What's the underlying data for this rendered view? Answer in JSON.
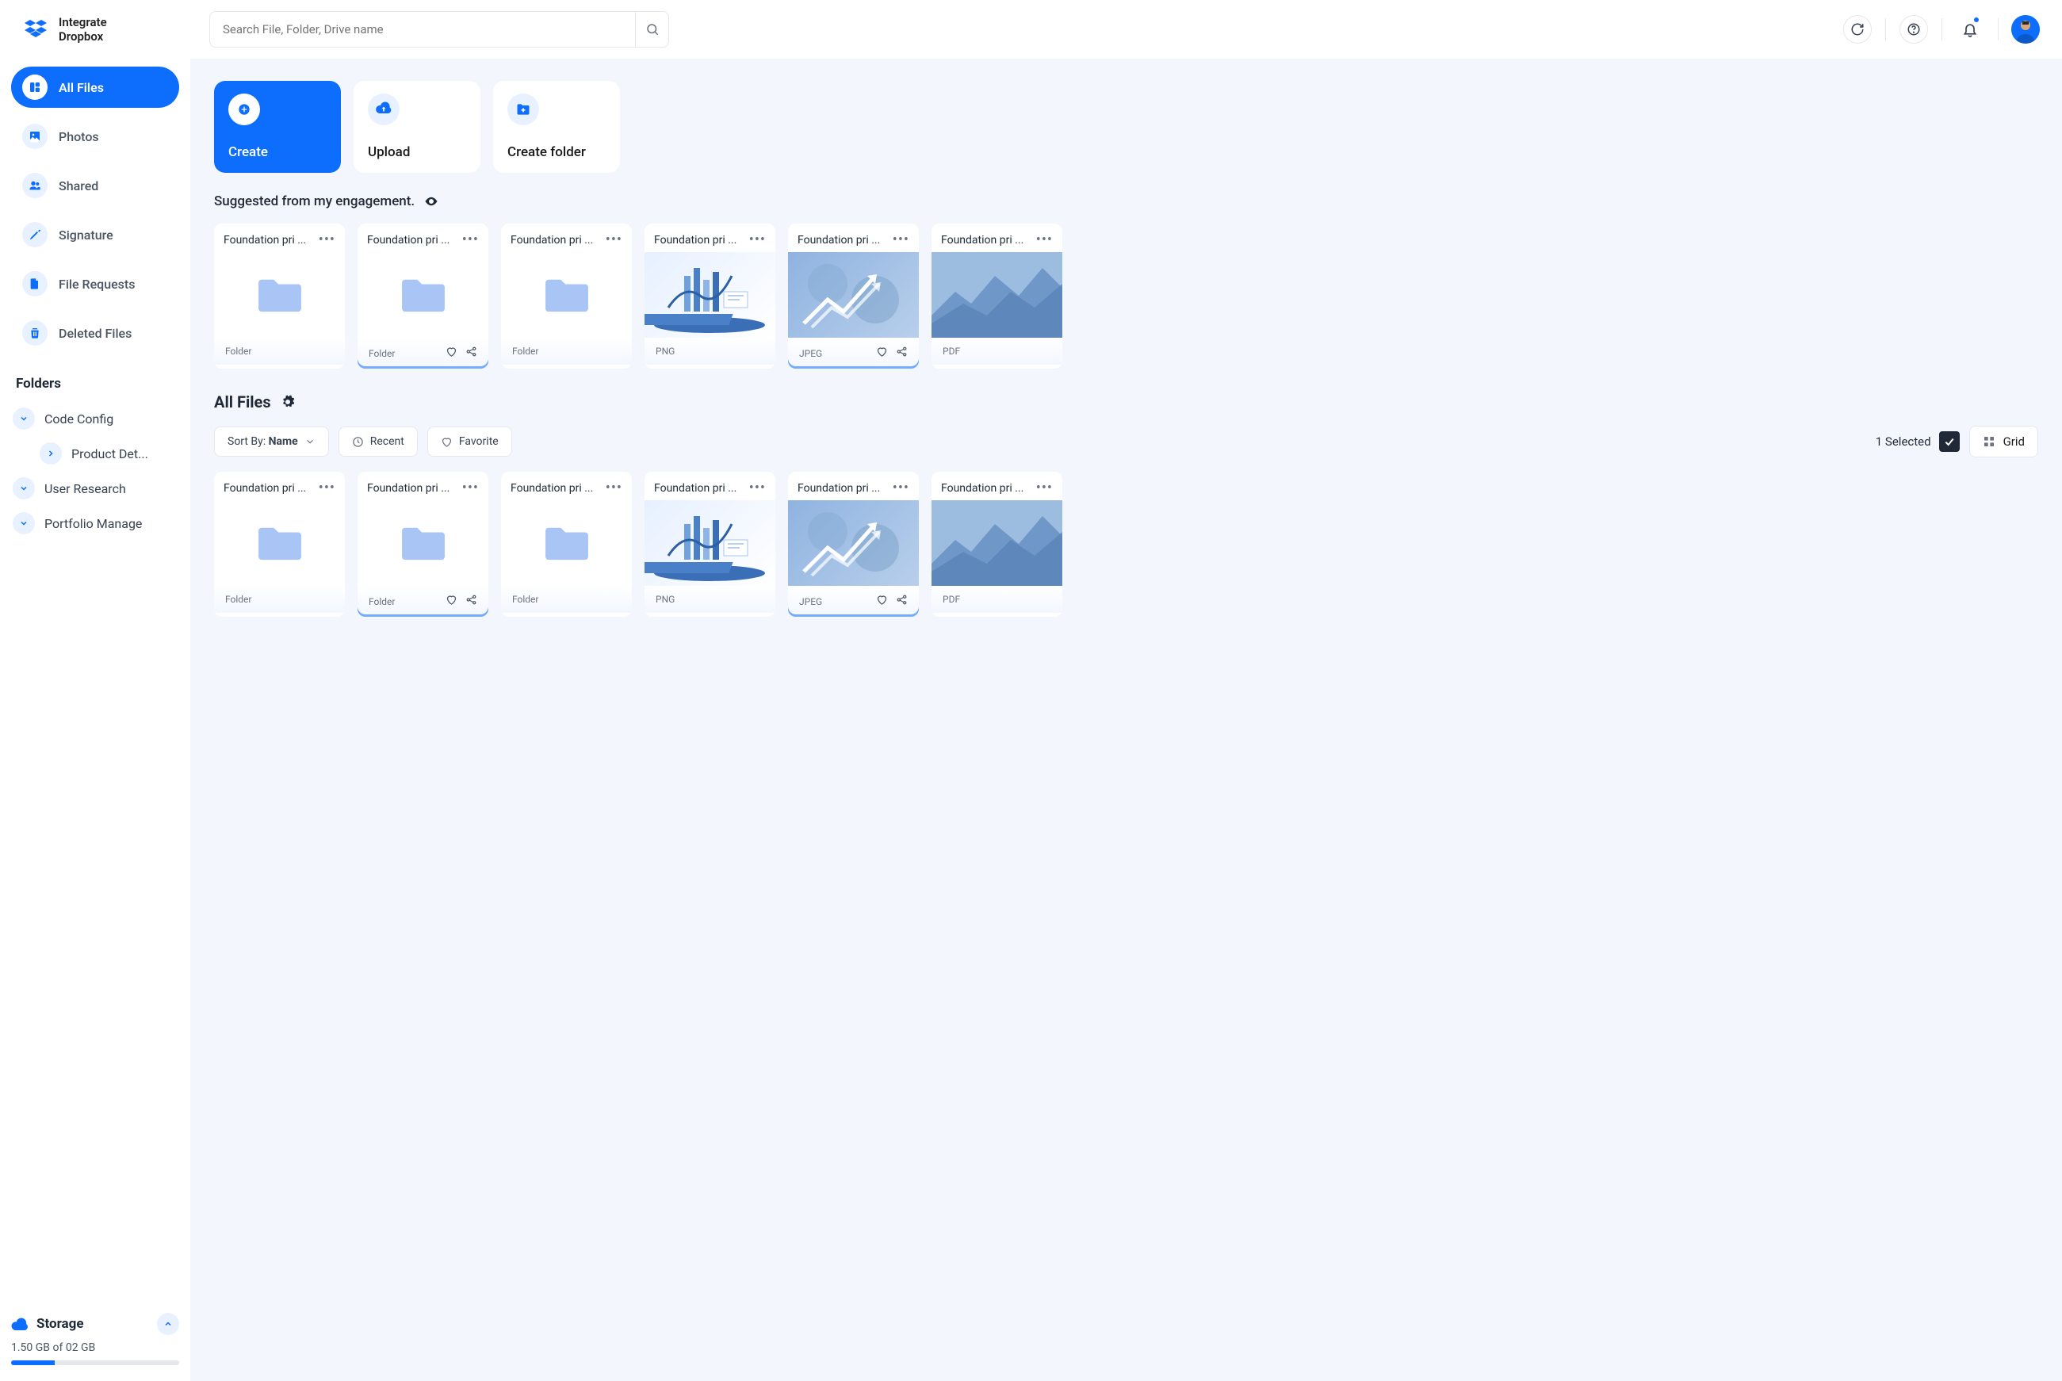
{
  "brand": {
    "line1": "Integrate",
    "line2": "Dropbox"
  },
  "search": {
    "placeholder": "Search File, Folder, Drive name"
  },
  "sidebar": {
    "nav": [
      {
        "label": "All Files",
        "icon": "grid"
      },
      {
        "label": "Photos",
        "icon": "image"
      },
      {
        "label": "Shared",
        "icon": "people"
      },
      {
        "label": "Signature",
        "icon": "pen"
      },
      {
        "label": "File Requests",
        "icon": "file"
      },
      {
        "label": "Deleted Files",
        "icon": "trash"
      }
    ],
    "folders_title": "Folders",
    "folders": [
      {
        "label": "Code Config",
        "children": [
          {
            "label": "Product Det..."
          }
        ]
      },
      {
        "label": "User Research"
      },
      {
        "label": "Portfolio Manage"
      }
    ],
    "storage": {
      "label": "Storage",
      "usage": "1.50 GB of 02 GB",
      "percent": 26
    }
  },
  "actions": [
    {
      "label": "Create",
      "icon": "plus",
      "primary": true
    },
    {
      "label": "Upload",
      "icon": "upload",
      "primary": false
    },
    {
      "label": "Create folder",
      "icon": "folder-plus",
      "primary": false
    }
  ],
  "suggested": {
    "title": "Suggested from my engagement.",
    "items": [
      {
        "name": "Foundation pri ...",
        "type": "Folder",
        "thumb": "folder",
        "selected": false,
        "actions": false
      },
      {
        "name": "Foundation pri ...",
        "type": "Folder",
        "thumb": "folder",
        "selected": true,
        "actions": true
      },
      {
        "name": "Foundation pri ...",
        "type": "Folder",
        "thumb": "folder",
        "selected": false,
        "actions": false
      },
      {
        "name": "Foundation pri ...",
        "type": "PNG",
        "thumb": "analytics",
        "selected": false,
        "actions": false
      },
      {
        "name": "Foundation pri ...",
        "type": "JPEG",
        "thumb": "growth",
        "selected": true,
        "actions": true
      },
      {
        "name": "Foundation pri ...",
        "type": "PDF",
        "thumb": "mountain",
        "selected": false,
        "actions": false
      }
    ]
  },
  "allfiles": {
    "title": "All Files",
    "sort_prefix": "Sort By:",
    "sort_value": "Name",
    "recent": "Recent",
    "favorite": "Favorite",
    "selected_count": "1 Selected",
    "view": "Grid",
    "items": [
      {
        "name": "Foundation pri ...",
        "type": "Folder",
        "thumb": "folder",
        "selected": false,
        "actions": false
      },
      {
        "name": "Foundation pri ...",
        "type": "Folder",
        "thumb": "folder",
        "selected": true,
        "actions": true
      },
      {
        "name": "Foundation pri ...",
        "type": "Folder",
        "thumb": "folder",
        "selected": false,
        "actions": false
      },
      {
        "name": "Foundation pri ...",
        "type": "PNG",
        "thumb": "analytics",
        "selected": false,
        "actions": false
      },
      {
        "name": "Foundation pri ...",
        "type": "JPEG",
        "thumb": "growth",
        "selected": true,
        "actions": true
      },
      {
        "name": "Foundation pri ...",
        "type": "PDF",
        "thumb": "mountain",
        "selected": false,
        "actions": false
      }
    ]
  }
}
